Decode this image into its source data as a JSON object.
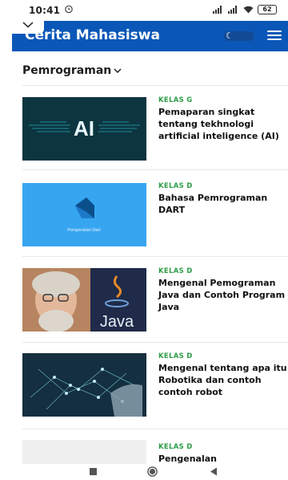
{
  "status_bar": {
    "time": "10:41",
    "battery": "62"
  },
  "app_bar": {
    "title": "Cerita Mahasiswa"
  },
  "category": {
    "label": "Pemrograman"
  },
  "articles": [
    {
      "kelas": "KELAS G",
      "title": "Pemaparan singkat tentang tekhnologi artificial inteligence (AI)",
      "thumb_text": "AI"
    },
    {
      "kelas": "KELAS D",
      "title": "Bahasa Pemrograman DART",
      "thumb_text": "Pengenalan Dart"
    },
    {
      "kelas": "KELAS D",
      "title": "Mengenal Pemograman Java dan Contoh Program Java",
      "thumb_text": "Java"
    },
    {
      "kelas": "KELAS D",
      "title": "Mengenal tentang apa itu Robotika dan contoh contoh robot",
      "thumb_text": ""
    },
    {
      "kelas": "KELAS D",
      "title": "Pengenalan",
      "thumb_text": ""
    }
  ],
  "colors": {
    "primary": "#0a57b8",
    "kelas_green": "#2e9d48"
  },
  "icons": {
    "status_left": "alarm-icon",
    "signal": "signal-icon",
    "wifi": "wifi-icon",
    "collapse": "chevron-down-icon",
    "theme": "moon-icon",
    "menu": "menu-icon",
    "category_chevron": "chevron-down-icon",
    "nav_recent": "square-icon",
    "nav_home": "circle-icon",
    "nav_back": "triangle-back-icon"
  }
}
